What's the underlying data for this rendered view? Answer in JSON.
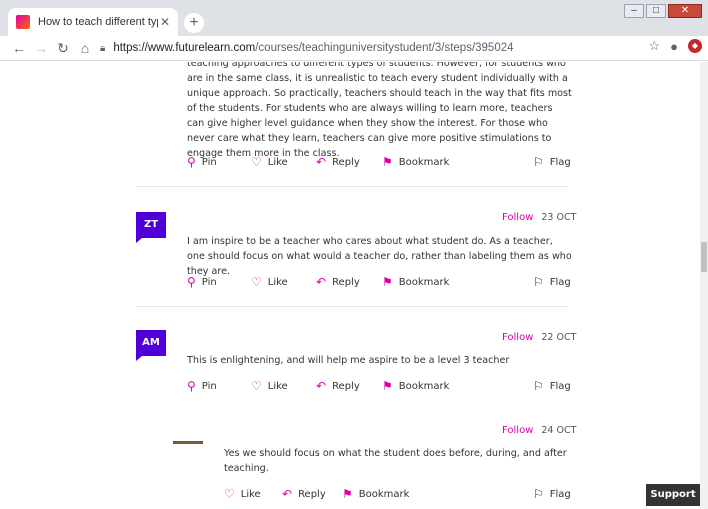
{
  "browser": {
    "tab_title": "How to teach different types of s",
    "tab_close": "✕",
    "new_tab": "+",
    "url_host": "https://www.futurelearn.com",
    "url_path": "/courses/teachinguniversitystudent/3/steps/395024"
  },
  "previous_comment": {
    "text": "teaching approaches to different types of students. However, for students who are in the same class, it is unrealistic to teach every student individually with a unique approach. So practically, teachers should teach in the way that fits most of the students. For students who are always willing to learn more, teachers can give higher level guidance when they show the interest. For those who never care what they learn, teachers can give more positive stimulations to engage them more in the class."
  },
  "actions": {
    "pin": "Pin",
    "like": "Like",
    "reply": "Reply",
    "bookmark": "Bookmark",
    "flag": "Flag"
  },
  "comments": [
    {
      "initials": "ZT",
      "follow": "Follow",
      "date": "23 OCT",
      "text": "I am inspire to be a teacher who cares about what student do. As a teacher, one should focus on what would a teacher do, rather than labeling them as who they are."
    },
    {
      "initials": "AM",
      "follow": "Follow",
      "date": "22 OCT",
      "text": "This is enlightening, and will help me aspire to be a level 3 teacher"
    },
    {
      "initials": "",
      "follow": "Follow",
      "date": "24 OCT",
      "text": "Yes we should focus on what the student does before, during, and after teaching."
    }
  ],
  "support": "Support",
  "colors": {
    "accent": "#de00a5",
    "avatar": "#5000d6"
  }
}
